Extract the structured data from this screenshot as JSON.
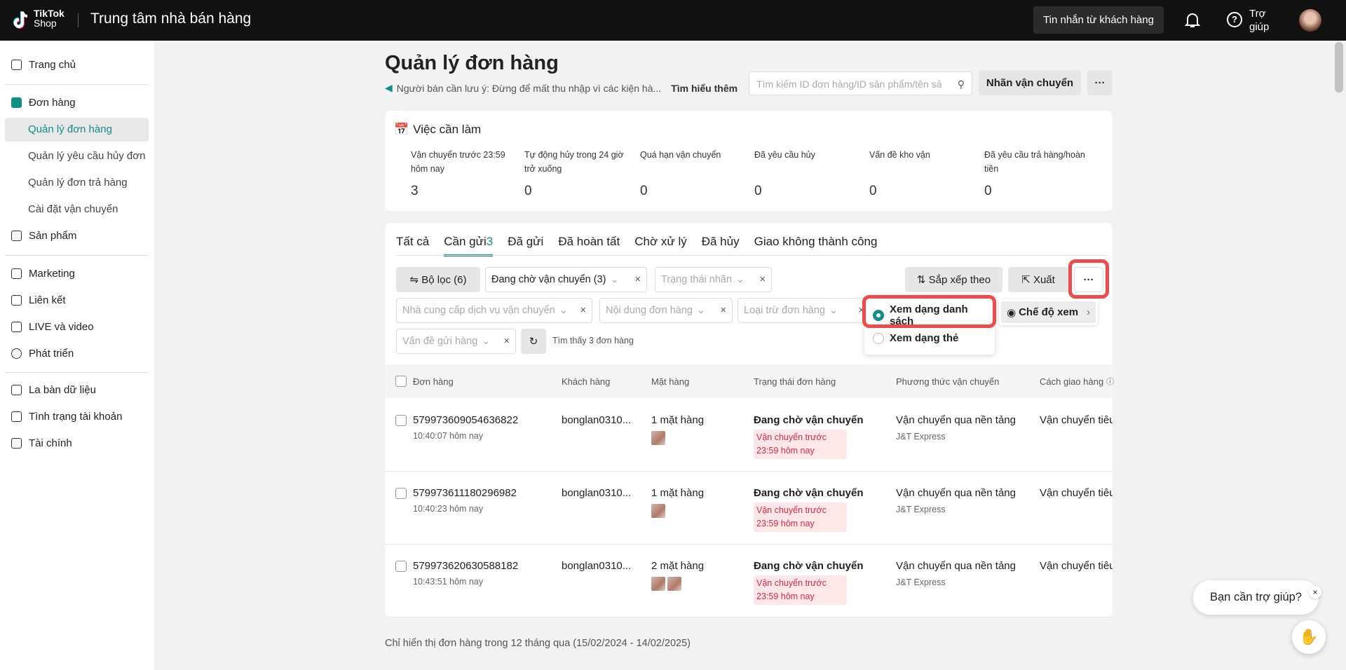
{
  "header": {
    "brand_top": "TikTok",
    "brand_bottom": "Shop",
    "title": "Trung tâm nhà bán hàng",
    "messages_button": "Tin nhắn từ khách hàng",
    "help_label": "Trợ giúp"
  },
  "sidebar": {
    "items": [
      {
        "label": "Trang chủ"
      },
      {
        "label": "Đơn hàng"
      },
      {
        "label": "Quản lý đơn hàng"
      },
      {
        "label": "Quản lý yêu cầu hủy đơn"
      },
      {
        "label": "Quản lý đơn trả hàng"
      },
      {
        "label": "Cài đặt vận chuyển"
      },
      {
        "label": "Sản phẩm"
      },
      {
        "label": "Marketing"
      },
      {
        "label": "Liên kết"
      },
      {
        "label": "LIVE và video"
      },
      {
        "label": "Phát triển"
      },
      {
        "label": "La bàn dữ liệu"
      },
      {
        "label": "Tình trạng tài khoản"
      },
      {
        "label": "Tài chính"
      }
    ]
  },
  "page": {
    "title": "Quản lý đơn hàng",
    "notice": "Người bán cần lưu ý: Đừng để mất thu nhập vì các kiện hà...",
    "learn_more": "Tìm hiểu thêm",
    "search_placeholder": "Tìm kiếm ID đơn hàng/ID sản phẩm/tên sả",
    "label_button": "Nhãn vận chuyển",
    "more": "···"
  },
  "todo": {
    "title": "Việc cần làm",
    "items": [
      {
        "label": "Vận chuyển trước 23:59 hôm nay",
        "count": "3"
      },
      {
        "label": "Tự động hủy trong 24 giờ trở xuống",
        "count": "0"
      },
      {
        "label": "Quá hạn vận chuyển",
        "count": "0"
      },
      {
        "label": "Đã yêu cầu hủy",
        "count": "0"
      },
      {
        "label": "Vấn đề kho vận",
        "count": "0"
      },
      {
        "label": "Đã yêu cầu trả hàng/hoàn tiền",
        "count": "0"
      }
    ]
  },
  "tabs": [
    {
      "label": "Tất cả"
    },
    {
      "label": "Cần gửi",
      "count": "3"
    },
    {
      "label": "Đã gửi"
    },
    {
      "label": "Đã hoàn tất"
    },
    {
      "label": "Chờ xử lý"
    },
    {
      "label": "Đã hủy"
    },
    {
      "label": "Giao không thành công"
    }
  ],
  "filters": {
    "filter_button": "Bộ lọc (6)",
    "status": "Đang chờ vận chuyển (3)",
    "label_status": "Trạng thái nhãn",
    "carrier": "Nhà cung cấp dịch vụ vận chuyển",
    "content": "Nội dung đơn hàng",
    "exclude": "Loại trừ đơn hàng",
    "shipping_issue": "Vấn đề gửi hàng",
    "found": "Tìm thấy 3 đơn hàng",
    "sort": "Sắp xếp theo",
    "export": "Xuất",
    "more": "···"
  },
  "view_menu": {
    "list": "Xem dạng danh sách",
    "card": "Xem dạng thẻ",
    "mode": "Chế độ xem",
    "selected": "list"
  },
  "table": {
    "columns": [
      "Đơn hàng",
      "Khách hàng",
      "Mặt hàng",
      "Trạng thái đơn hàng",
      "Phương thức vận chuyển",
      "Cách giao hàng"
    ],
    "rows": [
      {
        "id": "579973609054636822",
        "time": "10:40:07 hôm nay",
        "customer": "bonglan0310...",
        "items": "1 mặt hàng",
        "thumbs": 1,
        "status": "Đang chờ vận chuyển",
        "deadline": "Vận chuyển trước 23:59 hôm nay",
        "method": "Vận chuyển qua nền tảng",
        "carrier": "J&T Express",
        "delivery": "Vận chuyển tiêu"
      },
      {
        "id": "579973611180296982",
        "time": "10:40:23 hôm nay",
        "customer": "bonglan0310...",
        "items": "1 mặt hàng",
        "thumbs": 1,
        "status": "Đang chờ vận chuyển",
        "deadline": "Vận chuyển trước 23:59 hôm nay",
        "method": "Vận chuyển qua nền tảng",
        "carrier": "J&T Express",
        "delivery": "Vận chuyển tiêu"
      },
      {
        "id": "579973620630588182",
        "time": "10:43:51 hôm nay",
        "customer": "bonglan0310...",
        "items": "2 mặt hàng",
        "thumbs": 2,
        "status": "Đang chờ vận chuyển",
        "deadline": "Vận chuyển trước 23:59 hôm nay",
        "method": "Vận chuyển qua nền tảng",
        "carrier": "J&T Express",
        "delivery": "Vận chuyển tiêu"
      }
    ]
  },
  "footer": "Chỉ hiển thị đơn hàng trong 12 tháng qua (15/02/2024 - 14/02/2025)",
  "help_bubble": "Bạn cần trợ giúp?",
  "colors": {
    "accent": "#0f8f88",
    "highlight": "#f04a4a",
    "deadline": "#e4293d"
  }
}
